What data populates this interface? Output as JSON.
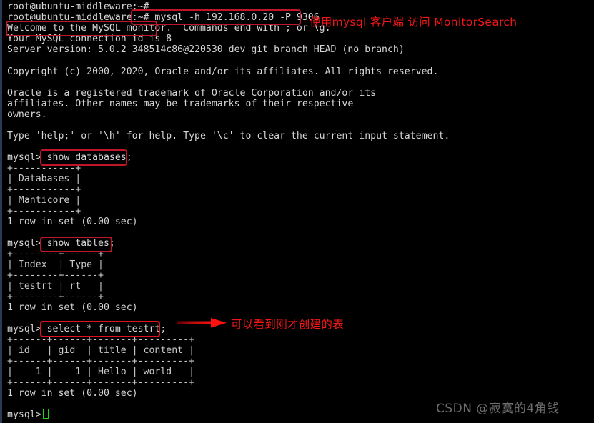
{
  "terminal": {
    "prompt": "mysql>",
    "shell_prompt": "root@ubuntu-middleware:~#",
    "background_color": "#000000",
    "text_color": "#d6d6d6",
    "lines": [
      "root@ubuntu-middleware:~#",
      "root@ubuntu-middleware:~# mysql -h 192.168.0.20 -P 9306",
      "Welcome to the MySQL monitor.  Commands end with ; or \\g.",
      "Your MySQL connection id is 8",
      "Server version: 5.0.2 348514c86@220530 dev git branch HEAD (no branch)",
      "",
      "Copyright (c) 2000, 2020, Oracle and/or its affiliates. All rights reserved.",
      "",
      "Oracle is a registered trademark of Oracle Corporation and/or its",
      "affiliates. Other names may be trademarks of their respective",
      "owners.",
      "",
      "Type 'help;' or '\\h' for help. Type '\\c' to clear the current input statement.",
      "",
      "mysql> show databases;",
      "+-----------+",
      "| Databases |",
      "+-----------+",
      "| Manticore |",
      "+-----------+",
      "1 row in set (0.00 sec)",
      "",
      "mysql> show tables;",
      "+--------+------+",
      "| Index  | Type |",
      "+--------+------+",
      "| testrt | rt   |",
      "+--------+------+",
      "1 row in set (0.00 sec)",
      "",
      "mysql> select * from testrt;",
      "+------+------+-------+---------+",
      "| id   | gid  | title | content |",
      "+------+------+-------+---------+",
      "|    1 |    1 | Hello | world   |",
      "+------+------+-------+---------+",
      "1 row in set (0.00 sec)",
      "",
      "mysql> "
    ]
  },
  "commands": {
    "connect": "mysql -h 192.168.0.20 -P 9306",
    "show_databases": "show databases;",
    "show_tables": "show tables;",
    "select_rows": "select * from testrt;",
    "welcome_banner": "Welcome to the MySQL monitor."
  },
  "connection": {
    "host": "192.168.0.20",
    "port": "9306",
    "connection_id": "8",
    "server_version": "5.0.2 348514c86@220530 dev git branch HEAD (no branch)"
  },
  "results": {
    "databases": {
      "columns": [
        "Databases"
      ],
      "rows": [
        [
          "Manticore"
        ]
      ],
      "footer": "1 row in set (0.00 sec)"
    },
    "tables": {
      "columns": [
        "Index",
        "Type"
      ],
      "rows": [
        [
          "testrt",
          "rt"
        ]
      ],
      "footer": "1 row in set (0.00 sec)"
    },
    "testrt": {
      "columns": [
        "id",
        "gid",
        "title",
        "content"
      ],
      "rows": [
        [
          "1",
          "1",
          "Hello",
          "world"
        ]
      ],
      "footer": "1 row in set (0.00 sec)"
    }
  },
  "annotations": {
    "connect_note": "使用mysql 客户端 访问 MonitorSearch",
    "table_note": "可以看到刚才创建的表",
    "highlight_color": "#c0162a",
    "note_color": "#f31616"
  },
  "watermark": {
    "text": "CSDN @寂寞的4角钱"
  }
}
